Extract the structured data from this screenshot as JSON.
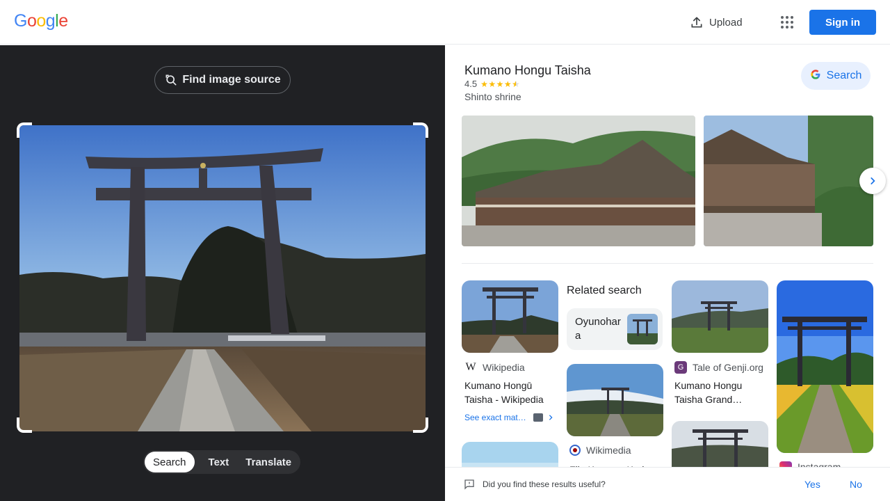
{
  "header": {
    "logo_letters": [
      "G",
      "o",
      "o",
      "g",
      "l",
      "e"
    ],
    "logo_colors": [
      "#4285f4",
      "#ea4335",
      "#fbbc05",
      "#4285f4",
      "#34a853",
      "#ea4335"
    ],
    "upload_label": "Upload",
    "signin_label": "Sign in"
  },
  "lens": {
    "find_source_label": "Find image source",
    "modes": [
      "Search",
      "Text",
      "Translate"
    ],
    "active_mode": "Search"
  },
  "knowledge_panel": {
    "title": "Kumano Hongu Taisha",
    "rating": "4.5",
    "stars": 4.5,
    "type": "Shinto shrine",
    "search_button_label": "Search"
  },
  "results": {
    "wikipedia": {
      "source": "Wikipedia",
      "title": "Kumano Hongū Taisha - Wikipedia",
      "see_exact": "See exact mat…"
    },
    "related": {
      "heading": "Related search",
      "item": "Oyunohara"
    },
    "wikimedia": {
      "source": "Wikimedia",
      "title": "File:Kumano Kod…"
    },
    "genji": {
      "source": "Tale of Genji.org",
      "title": "Kumano Hongu Taisha Grand…"
    },
    "instagram": {
      "source": "Instagram"
    }
  },
  "feedback": {
    "question": "Did you find these results useful?",
    "yes": "Yes",
    "no": "No"
  },
  "colors": {
    "accent": "#1a73e8",
    "dark_pane": "#202124",
    "star": "#fbbc04"
  }
}
